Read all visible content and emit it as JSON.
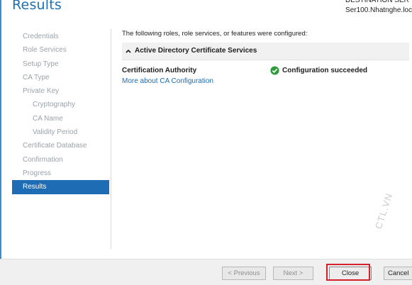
{
  "window": {
    "title": "Results",
    "destination_server_partial": "DESTINATION SERVE",
    "server_name": "Ser100.Nhatnghe.loc"
  },
  "nav": {
    "items": [
      {
        "label": "Credentials",
        "level": 0,
        "state": "disabled"
      },
      {
        "label": "Role Services",
        "level": 0,
        "state": "disabled"
      },
      {
        "label": "Setup Type",
        "level": 0,
        "state": "disabled"
      },
      {
        "label": "CA Type",
        "level": 0,
        "state": "disabled"
      },
      {
        "label": "Private Key",
        "level": 0,
        "state": "disabled"
      },
      {
        "label": "Cryptography",
        "level": 1,
        "state": "disabled"
      },
      {
        "label": "CA Name",
        "level": 1,
        "state": "disabled"
      },
      {
        "label": "Validity Period",
        "level": 1,
        "state": "disabled"
      },
      {
        "label": "Certificate Database",
        "level": 0,
        "state": "disabled"
      },
      {
        "label": "Confirmation",
        "level": 0,
        "state": "disabled"
      },
      {
        "label": "Progress",
        "level": 0,
        "state": "disabled"
      },
      {
        "label": "Results",
        "level": 0,
        "state": "active"
      }
    ]
  },
  "main": {
    "intro": "The following roles, role services, or features were configured:",
    "section_title": "Active Directory Certificate Services",
    "result_name": "Certification Authority",
    "result_link": "More about CA Configuration",
    "status_text": "Configuration succeeded",
    "status_icon": "green-check-icon"
  },
  "footer": {
    "previous_label": "< Previous",
    "next_label": "Next >",
    "close_label": "Close",
    "cancel_label": "Cancel"
  },
  "watermark": "CTL.VN",
  "colors": {
    "accent": "#1e6cb4",
    "success": "#2e9b3a",
    "highlight": "#d4202a"
  }
}
